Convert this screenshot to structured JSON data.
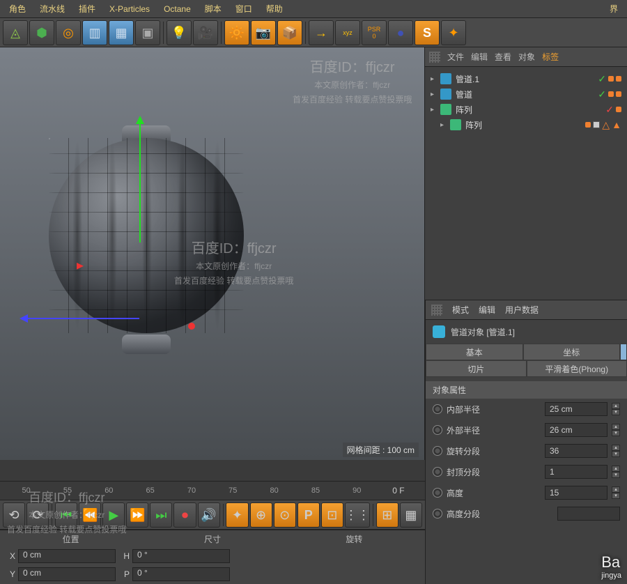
{
  "menu": {
    "items": [
      "角色",
      "流水线",
      "插件",
      "X-Particles",
      "Octane",
      "脚本",
      "窗口",
      "帮助"
    ],
    "far": "界"
  },
  "toolbar_icons": [
    "◬",
    "⬢",
    "◎",
    "▥",
    "▦",
    "▣",
    "💡",
    "🎥",
    "🔆",
    "📷",
    "📦",
    "→",
    "xyz",
    "PSR\n0",
    "●",
    "S",
    "✦"
  ],
  "viewport": {
    "grid_label": "网格间距 : 100 cm"
  },
  "hier": {
    "tabs": [
      "文件",
      "编辑",
      "查看",
      "对象",
      "标签"
    ],
    "items": [
      {
        "icon": "tube",
        "name": "管道.1",
        "ind": [
          "chk",
          "dot",
          "dot"
        ]
      },
      {
        "icon": "tube",
        "name": "管道",
        "ind": [
          "chk",
          "dot",
          "dot"
        ]
      },
      {
        "icon": "arr",
        "name": "阵列",
        "ind": [
          "chk-red",
          "dot"
        ]
      },
      {
        "icon": "arr",
        "name": "阵列",
        "ind": [
          "dot",
          "sq",
          "tri",
          "tri"
        ],
        "indent": 1
      }
    ]
  },
  "attr": {
    "head": [
      "模式",
      "编辑",
      "用户数据"
    ],
    "title": "管道对象 [管道.1]",
    "tabs1": [
      "基本",
      "坐标"
    ],
    "tabs2": [
      "切片",
      "平滑着色(Phong)"
    ],
    "section": "对象属性",
    "props": [
      {
        "l": "内部半径",
        "v": "25 cm"
      },
      {
        "l": "外部半径",
        "v": "26 cm"
      },
      {
        "l": "旋转分段",
        "v": "36"
      },
      {
        "l": "封顶分段",
        "v": "1"
      },
      {
        "l": "高度",
        "v": "15"
      },
      {
        "l": "高度分段",
        "v": ""
      }
    ]
  },
  "timeline": {
    "ticks": [
      "50",
      "55",
      "60",
      "65",
      "70",
      "75",
      "80",
      "85",
      "90"
    ],
    "frame": "0 F"
  },
  "ctrl_icons": [
    "⟲",
    "⟳",
    "⏮",
    "⏪",
    "▶",
    "⏩",
    "⏭",
    "⏺",
    "🔊",
    "✦",
    "⊕",
    "⊙",
    "P",
    "⊡",
    "⋮⋮",
    "⊞",
    "▦"
  ],
  "coords": {
    "heads": [
      "位置",
      "尺寸",
      "旋转"
    ],
    "rows": [
      {
        "a": "X",
        "av": "",
        "b": "X",
        "bv": "0 cm",
        "c": "H",
        "cv": "0 °"
      },
      {
        "a": "Y",
        "av": "",
        "b": "Y",
        "bv": "0 cm",
        "c": "P",
        "cv": "0 °"
      }
    ]
  },
  "wm": {
    "id": "百度ID：ffjczr",
    "l1": "本文原创作者：ffjczr",
    "l2": "首发百度经验 转载要点赞投票哦"
  },
  "brand": {
    "main": "Ba",
    "sub": "jingya"
  }
}
